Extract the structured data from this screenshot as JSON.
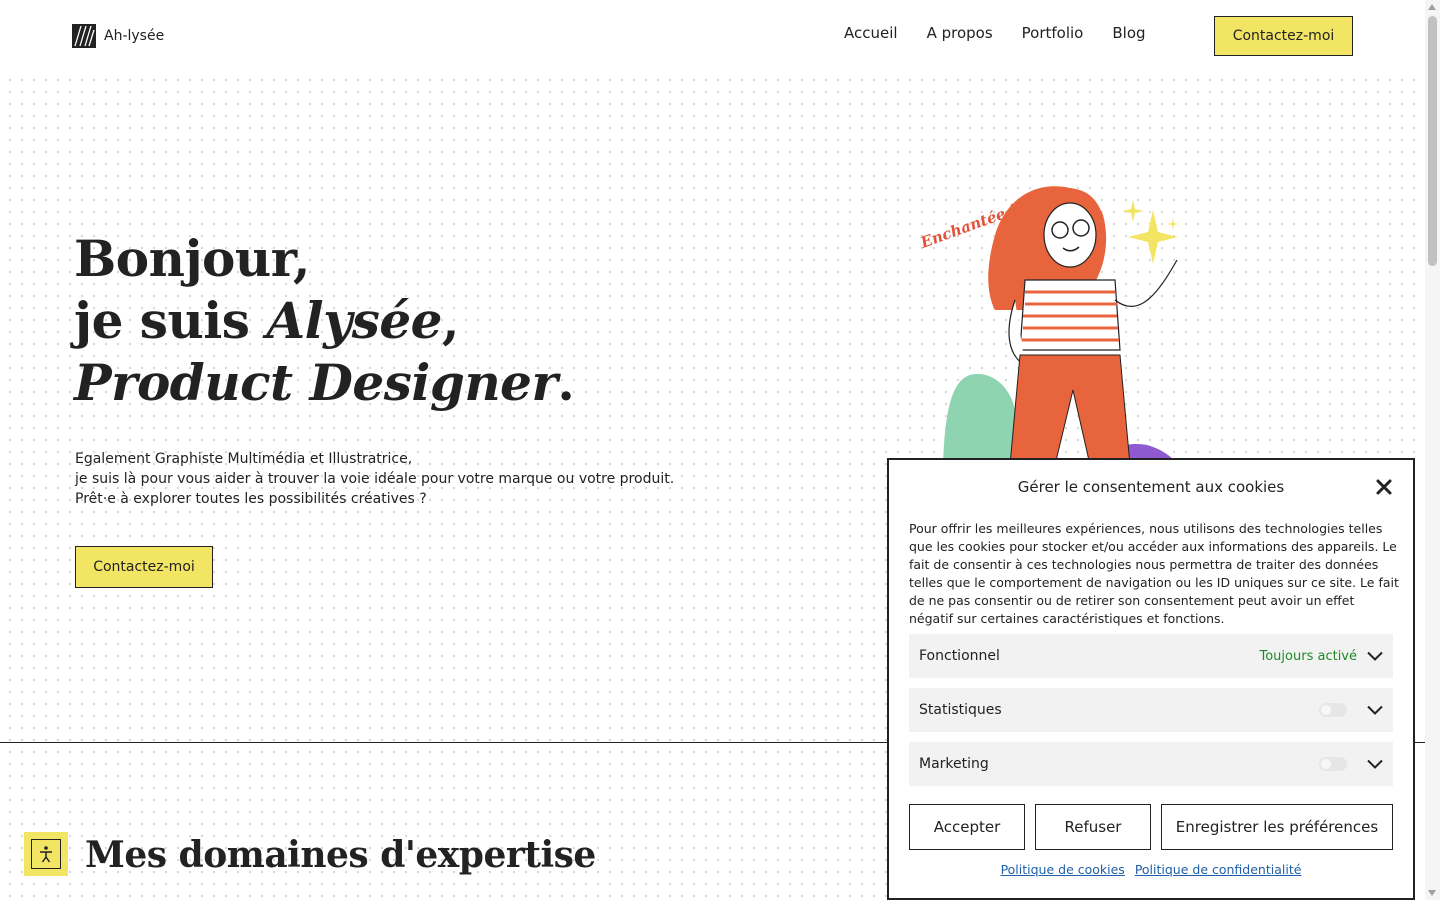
{
  "header": {
    "logo_text": "Ah-lysée",
    "nav": [
      "Accueil",
      "A propos",
      "Portfolio",
      "Blog"
    ],
    "cta": "Contactez-moi"
  },
  "hero": {
    "line1": "Bonjour,",
    "line2_prefix": "je suis ",
    "line2_name": "Alysée",
    "line2_suffix": ",",
    "line3_role": "Product Designer",
    "line3_suffix": ".",
    "subtitle": [
      "Egalement Graphiste Multimédia et Illustratrice,",
      "je suis là pour vous aider à trouver la voie idéale pour votre marque ou votre produit.",
      "Prêt·e à explorer toutes les possibilités créatives ?"
    ],
    "cta": "Contactez-moi",
    "illustration_caption": "Enchantée !"
  },
  "section": {
    "title": "Mes domaines d'expertise"
  },
  "cookie": {
    "title": "Gérer le consentement aux cookies",
    "text": "Pour offrir les meilleures expériences, nous utilisons des technologies telles que les cookies pour stocker et/ou accéder aux informations des appareils. Le fait de consentir à ces technologies nous permettra de traiter des données telles que le comportement de navigation ou les ID uniques sur ce site. Le fait de ne pas consentir ou de retirer son consentement peut avoir un effet négatif sur certaines caractéristiques et fonctions.",
    "categories": [
      {
        "label": "Fonctionnel",
        "status": "Toujours activé"
      },
      {
        "label": "Statistiques",
        "enabled": false
      },
      {
        "label": "Marketing",
        "enabled": false
      }
    ],
    "buttons": {
      "accept": "Accepter",
      "refuse": "Refuser",
      "save": "Enregistrer les préférences"
    },
    "links": {
      "cookies_policy": "Politique de cookies",
      "privacy_policy": "Politique de confidentialité"
    }
  },
  "colors": {
    "accent_yellow": "#f3e564",
    "text": "#222222",
    "always_on_green": "#1e8a26",
    "link_blue": "#1e5fa8"
  },
  "icons": [
    "logo-mark-icon",
    "close-icon",
    "chevron-down-icon",
    "accessibility-icon"
  ]
}
